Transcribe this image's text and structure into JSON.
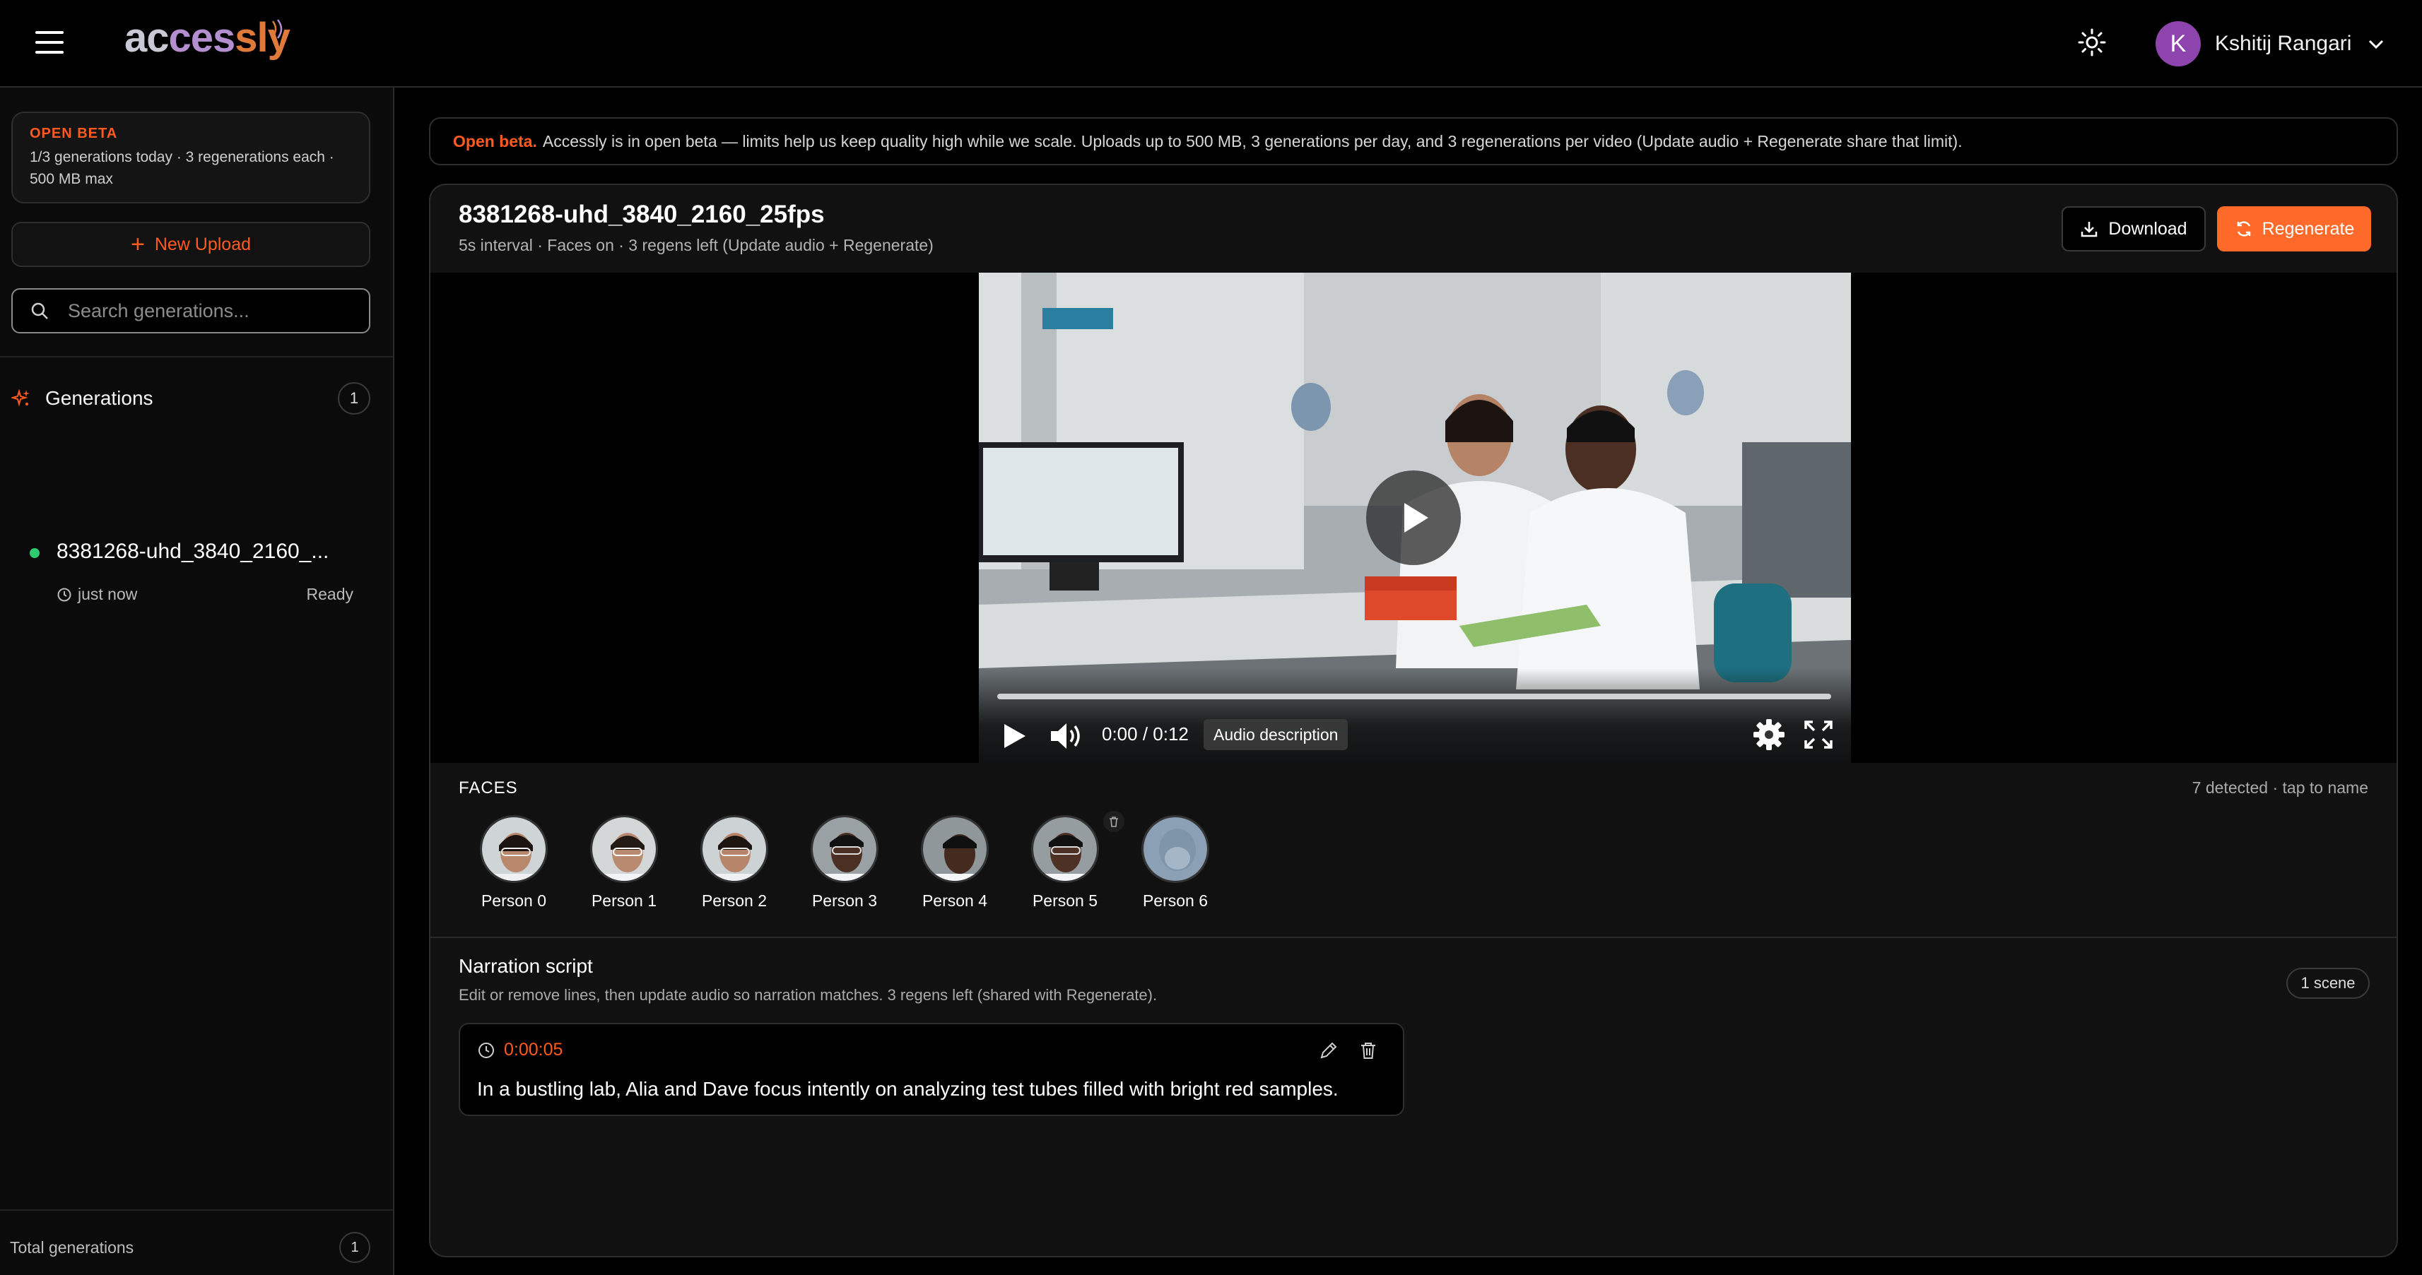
{
  "app": {
    "logo_part1": "ac",
    "logo_part2": "ces",
    "logo_part3": "sly",
    "accent_color": "#ff5a1f"
  },
  "header": {
    "user_initial": "K",
    "user_name": "Kshitij Rangari",
    "avatar_color": "#8e44ad"
  },
  "sidebar": {
    "beta_card_title": "OPEN BETA",
    "beta_card_text": "1/3 generations today · 3 regenerations each · 500 MB max",
    "new_upload_label": "New Upload",
    "search_placeholder": "Search generations...",
    "generations_title": "Generations",
    "generations_count": "1",
    "items": [
      {
        "name": "8381268-uhd_3840_2160_...",
        "time": "just now",
        "status": "Ready",
        "status_color": "#2ecc71"
      }
    ],
    "total_label": "Total generations",
    "total_count": "1"
  },
  "banner": {
    "strong": "Open beta.",
    "text": "Accessly is in open beta — limits help us keep quality high while we scale. Uploads up to 500 MB, 3 generations per day, and 3 regenerations per video (Update audio + Regenerate share that limit)."
  },
  "video": {
    "title": "8381268-uhd_3840_2160_25fps",
    "meta": "5s interval · Faces on · 3 regens left (Update audio + Regenerate)",
    "download_label": "Download",
    "regenerate_label": "Regenerate",
    "current_time": "0:00",
    "duration": "0:12",
    "time_display": "0:00 / 0:12",
    "audio_description_label": "Audio description",
    "progress": 0
  },
  "faces": {
    "label": "FACES",
    "hint": "7 detected · tap to name",
    "items": [
      {
        "name": "Person 0"
      },
      {
        "name": "Person 1"
      },
      {
        "name": "Person 2"
      },
      {
        "name": "Person 3"
      },
      {
        "name": "Person 4"
      },
      {
        "name": "Person 5"
      },
      {
        "name": "Person 6"
      }
    ]
  },
  "script": {
    "title": "Narration script",
    "subtitle": "Edit or remove lines, then update audio so narration matches. 3 regens left (shared with Regenerate).",
    "scene_count": "1 scene",
    "lines": [
      {
        "time": "0:00:05",
        "text": "In a bustling lab, Alia and Dave focus intently on analyzing test tubes filled with bright red samples."
      }
    ]
  }
}
